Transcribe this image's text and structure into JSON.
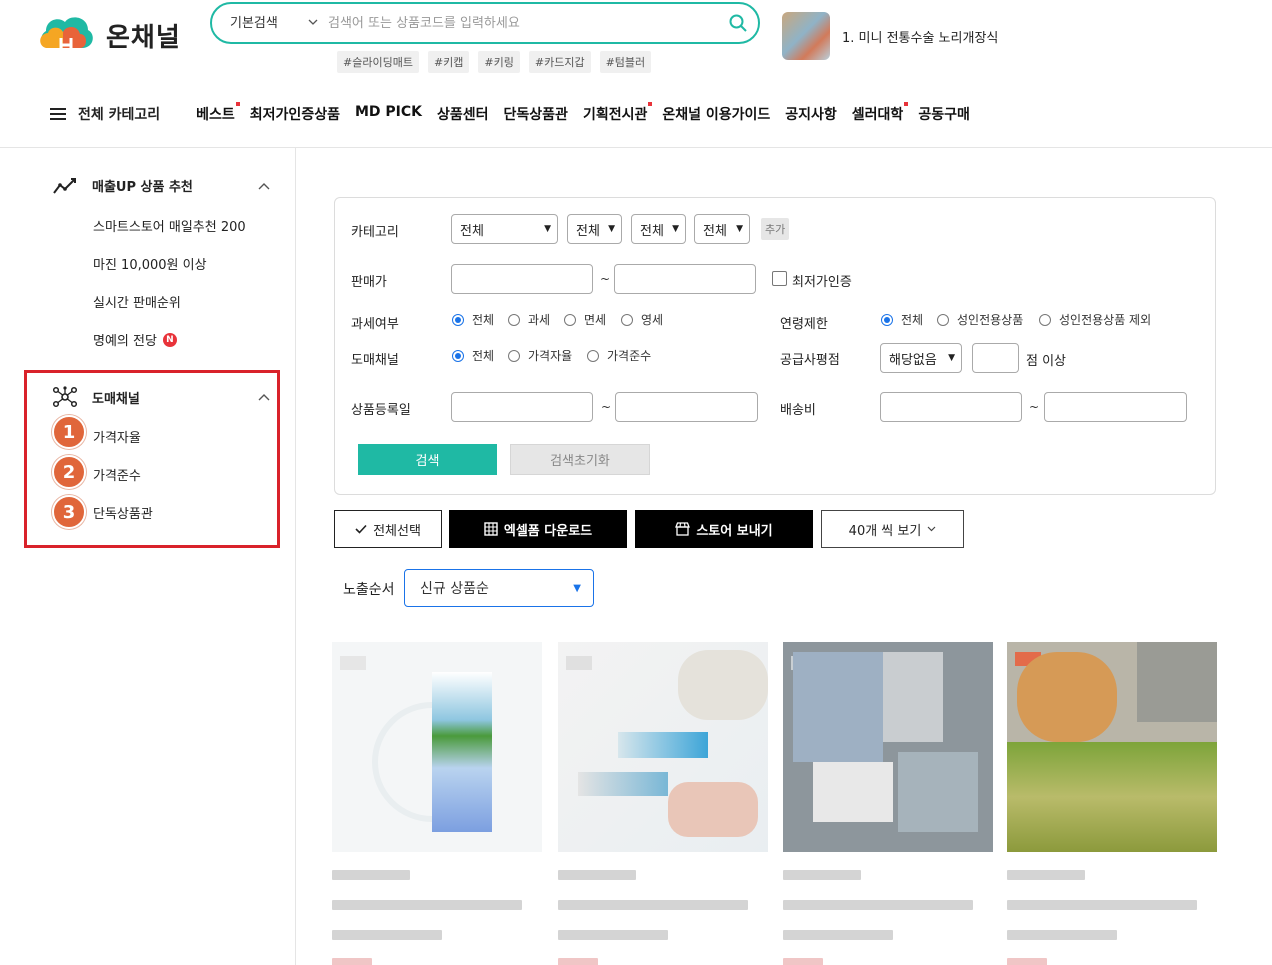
{
  "logo": {
    "text": "온채널"
  },
  "search": {
    "type": "기본검색",
    "placeholder": "검색어 또는 상품코드를 입력하세요"
  },
  "tags": [
    "#슬라이딩매트",
    "#키캡",
    "#키링",
    "#카드지갑",
    "#텀블러"
  ],
  "promo": {
    "text": "1. 미니 전통수술 노리개장식"
  },
  "gnb": {
    "all_categories": "전체 카테고리",
    "items": [
      {
        "label": "베스트",
        "dot": true
      },
      {
        "label": "최저가인증상품",
        "dot": false
      },
      {
        "label": "MD PICK",
        "dot": false
      },
      {
        "label": "상품센터",
        "dot": false
      },
      {
        "label": "단독상품관",
        "dot": false
      },
      {
        "label": "기획전시관",
        "dot": true
      },
      {
        "label": "온채널 이용가이드",
        "dot": false
      },
      {
        "label": "공지사항",
        "dot": false
      },
      {
        "label": "셀러대학",
        "dot": true
      },
      {
        "label": "공동구매",
        "dot": false
      }
    ]
  },
  "sidebar": {
    "section1": {
      "title": "매출UP 상품 추천",
      "items": [
        "스마트스토어 매일추천 200",
        "마진 10,000원 이상",
        "실시간 판매순위",
        "명예의 전당"
      ],
      "new_badge": "N"
    },
    "section2": {
      "title": "도매채널",
      "items": [
        "가격자율",
        "가격준수",
        "단독상품관"
      ],
      "markers": [
        "1",
        "2",
        "3"
      ]
    }
  },
  "filter": {
    "category_label": "카테고리",
    "category_selects": [
      "전체",
      "전체",
      "전체",
      "전체"
    ],
    "add_label": "추가",
    "price_label": "판매가",
    "tilde": "~",
    "lowest_cert_label": "최저가인증",
    "tax_label": "과세여부",
    "tax_options": [
      "전체",
      "과세",
      "면세",
      "영세"
    ],
    "tax_selected": 0,
    "age_label": "연령제한",
    "age_options": [
      "전체",
      "성인전용상품",
      "성인전용상품 제외"
    ],
    "age_selected": 0,
    "channel_label": "도매채널",
    "channel_options": [
      "전체",
      "가격자율",
      "가격준수"
    ],
    "channel_selected": 0,
    "rating_label": "공급사평점",
    "rating_select": "해당없음",
    "rating_suffix": "점 이상",
    "regdate_label": "상품등록일",
    "shipping_label": "배송비",
    "search_button": "검색",
    "reset_button": "검색초기화"
  },
  "actions": {
    "select_all": "전체선택",
    "excel_download": "엑셀폼 다운로드",
    "send_store": "스토어 보내기",
    "per_page": "40개 씩 보기"
  },
  "sort": {
    "label": "노출순서",
    "value": "신규 상품순"
  },
  "colors": {
    "accent": "#1fb9a4",
    "highlight_border": "#d9222a",
    "badge": "#e0663a",
    "sort_border": "#1a73e8"
  }
}
